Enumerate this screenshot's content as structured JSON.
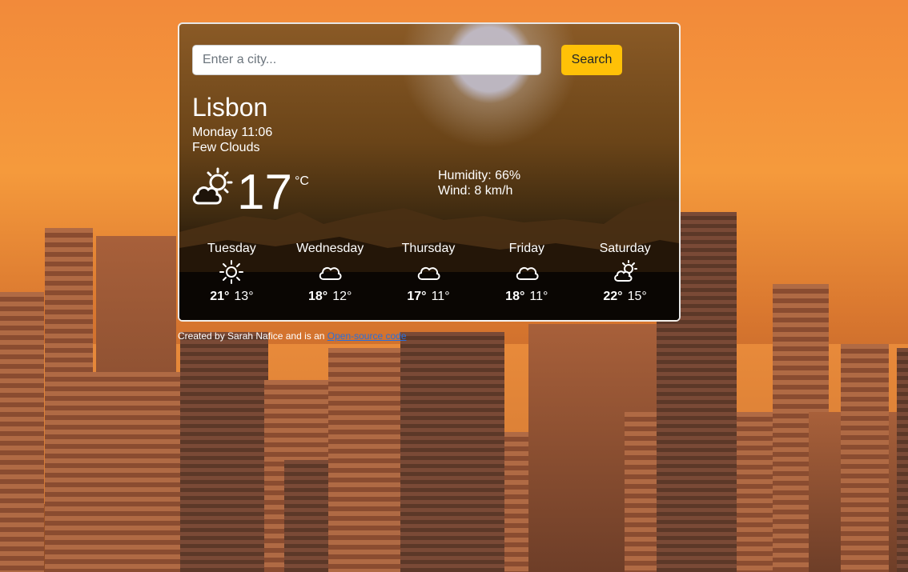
{
  "search": {
    "placeholder": "Enter a city...",
    "button_label": "Search"
  },
  "current": {
    "city": "Lisbon",
    "datetime": "Monday 11:06",
    "description": "Few Clouds",
    "icon": "partly-cloudy-icon",
    "temperature": "17",
    "unit": "°C",
    "humidity": "Humidity: 66%",
    "wind": "Wind: 8 km/h"
  },
  "forecast": [
    {
      "day": "Tuesday",
      "icon": "sun-icon",
      "max": "21°",
      "min": "13°"
    },
    {
      "day": "Wednesday",
      "icon": "cloud-icon",
      "max": "18°",
      "min": "12°"
    },
    {
      "day": "Thursday",
      "icon": "cloud-icon",
      "max": "17°",
      "min": "11°"
    },
    {
      "day": "Friday",
      "icon": "cloud-icon",
      "max": "18°",
      "min": "11°"
    },
    {
      "day": "Saturday",
      "icon": "partly-cloudy-icon",
      "max": "22°",
      "min": "15°"
    }
  ],
  "footer": {
    "text": "Created by Sarah Nafice and is an ",
    "link_label": "Open-source code"
  },
  "colors": {
    "accent": "#ffc107",
    "link": "#2a6fdb"
  }
}
